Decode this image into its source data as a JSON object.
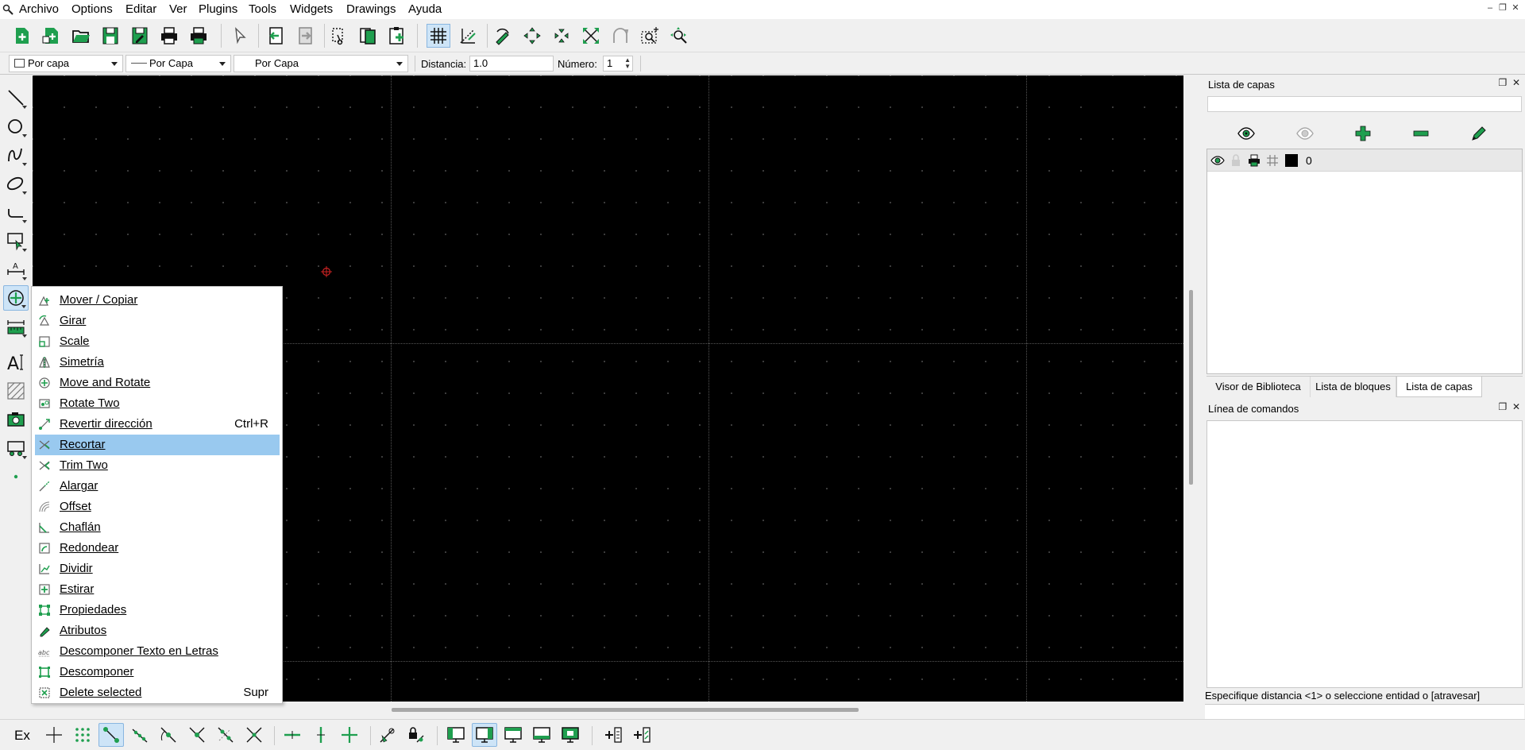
{
  "menubar": {
    "items": [
      "Archivo",
      "Options",
      "Editar",
      "Ver",
      "Plugins",
      "Tools",
      "Widgets",
      "Drawings",
      "Ayuda"
    ]
  },
  "toolbar2": {
    "color_combo": "Por capa",
    "linetype_combo": "Por Capa",
    "linewidth_combo": "Por Capa",
    "distance_label": "Distancia:",
    "distance_value": "1.0",
    "number_label": "Número:",
    "number_value": "1"
  },
  "context_menu": {
    "items": [
      {
        "label": "Mover / Copiar",
        "shortcut": "",
        "icon": "move-copy-icon"
      },
      {
        "label": "Girar",
        "shortcut": "",
        "icon": "rotate-icon"
      },
      {
        "label": "Scale",
        "shortcut": "",
        "icon": "scale-icon"
      },
      {
        "label": "Simetría",
        "shortcut": "",
        "icon": "mirror-icon"
      },
      {
        "label": "Move and Rotate",
        "shortcut": "",
        "icon": "move-rotate-icon"
      },
      {
        "label": "Rotate Two",
        "shortcut": "",
        "icon": "rotate-two-icon"
      },
      {
        "label": "Revertir dirección",
        "shortcut": "Ctrl+R",
        "icon": "revert-direction-icon"
      },
      {
        "label": "Recortar",
        "shortcut": "",
        "icon": "trim-icon"
      },
      {
        "label": "Trim Two",
        "shortcut": "",
        "icon": "trim-two-icon"
      },
      {
        "label": "Alargar",
        "shortcut": "",
        "icon": "lengthen-icon"
      },
      {
        "label": "Offset",
        "shortcut": "",
        "icon": "offset-icon"
      },
      {
        "label": "Chaflán",
        "shortcut": "",
        "icon": "chamfer-icon"
      },
      {
        "label": "Redondear",
        "shortcut": "",
        "icon": "round-icon"
      },
      {
        "label": "Dividir",
        "shortcut": "",
        "icon": "divide-icon"
      },
      {
        "label": "Estirar",
        "shortcut": "",
        "icon": "stretch-icon"
      },
      {
        "label": "Propiedades",
        "shortcut": "",
        "icon": "properties-icon"
      },
      {
        "label": "Atributos",
        "shortcut": "",
        "icon": "attributes-icon"
      },
      {
        "label": "Descomponer Texto en Letras",
        "shortcut": "",
        "icon": "explode-text-icon"
      },
      {
        "label": "Descomponer",
        "shortcut": "",
        "icon": "explode-icon"
      },
      {
        "label": "Delete selected",
        "shortcut": "Supr",
        "icon": "delete-selected-icon"
      }
    ],
    "highlighted_index": 7,
    "highlight_color": "#99c9ef"
  },
  "layer_dock": {
    "title": "Lista de capas",
    "layers": [
      {
        "name": "0",
        "color": "#000000"
      }
    ],
    "tabs": [
      "Visor de Biblioteca",
      "Lista de bloques",
      "Lista de capas"
    ],
    "active_tab": "Lista de capas"
  },
  "command_dock": {
    "title": "Línea de comandos",
    "prompt": "Especifique distancia <1> o seleccione entidad o [atravesar]"
  },
  "snapbar": {
    "exclusive_label": "Ex"
  },
  "colors": {
    "accent_green": "#1f9f4f",
    "canvas_background": "#000000",
    "crosshair": "#cc2222"
  }
}
